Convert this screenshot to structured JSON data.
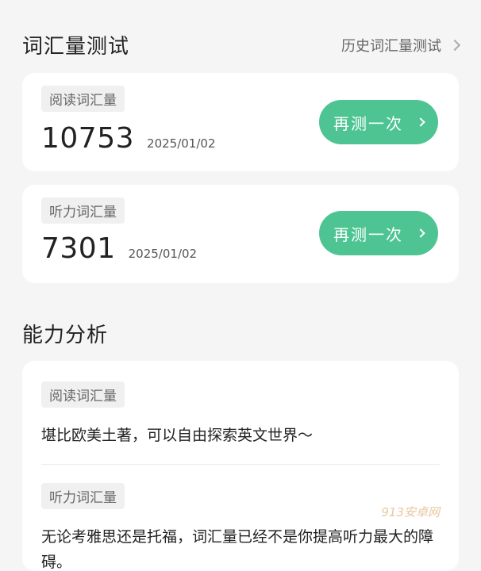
{
  "vocab_test": {
    "title": "词汇量测试",
    "history_label": "历史词汇量测试"
  },
  "reading": {
    "tag": "阅读词汇量",
    "score": "10753",
    "date": "2025/01/02",
    "button_label": "再测一次"
  },
  "listening": {
    "tag": "听力词汇量",
    "score": "7301",
    "date": "2025/01/02",
    "button_label": "再测一次"
  },
  "analysis": {
    "title": "能力分析",
    "reading_tag": "阅读词汇量",
    "reading_text": "堪比欧美土著，可以自由探索英文世界～",
    "listening_tag": "听力词汇量",
    "listening_text": "无论考雅思还是托福，词汇量已经不是你提高听力最大的障碍。"
  },
  "watermark": "913安卓网",
  "colors": {
    "accent": "#4ec493",
    "background": "#f5f5f5",
    "card": "#ffffff"
  }
}
